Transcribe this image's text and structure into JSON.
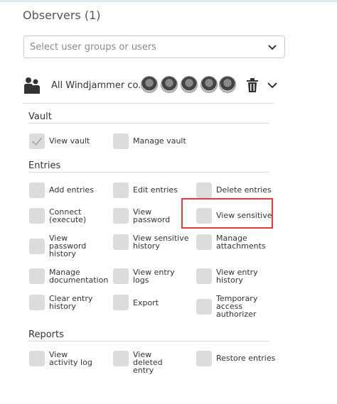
{
  "panel": {
    "title": "Observers (1)"
  },
  "selector": {
    "placeholder": "Select user groups or users"
  },
  "group": {
    "name": "All Windjammer co.",
    "avatar_count": 5
  },
  "sections": [
    {
      "id": "vault",
      "title": "Vault",
      "items": [
        {
          "label": "View vault",
          "checked": true
        },
        {
          "label": "Manage vault",
          "checked": false
        }
      ]
    },
    {
      "id": "entries",
      "title": "Entries",
      "items": [
        {
          "label": "Add entries",
          "checked": false
        },
        {
          "label": "Edit entries",
          "checked": false
        },
        {
          "label": "Delete entries",
          "checked": false
        },
        {
          "label": "Connect (execute)",
          "checked": false
        },
        {
          "label": "View password",
          "checked": false
        },
        {
          "label": "View sensitive",
          "checked": false,
          "highlighted": true
        },
        {
          "label": "View password history",
          "checked": false
        },
        {
          "label": "View sensitive history",
          "checked": false
        },
        {
          "label": "Manage attachments",
          "checked": false
        },
        {
          "label": "Manage documentation",
          "checked": false
        },
        {
          "label": "View entry logs",
          "checked": false
        },
        {
          "label": "View entry history",
          "checked": false
        },
        {
          "label": "Clear entry history",
          "checked": false
        },
        {
          "label": "Export",
          "checked": false
        },
        {
          "label": "Temporary access authorizer",
          "checked": false
        }
      ]
    },
    {
      "id": "reports",
      "title": "Reports",
      "items": [
        {
          "label": "View activity log",
          "checked": false
        },
        {
          "label": "View deleted entry",
          "checked": false
        },
        {
          "label": "Restore entries",
          "checked": false
        }
      ]
    }
  ],
  "icons": {
    "group": "users-group-icon",
    "delete": "trash-icon",
    "expand": "chevron-down-icon",
    "dropdown": "chevron-down-icon"
  },
  "colors": {
    "highlight": "#e53c3c",
    "checkbox": "#dcdcdc"
  }
}
